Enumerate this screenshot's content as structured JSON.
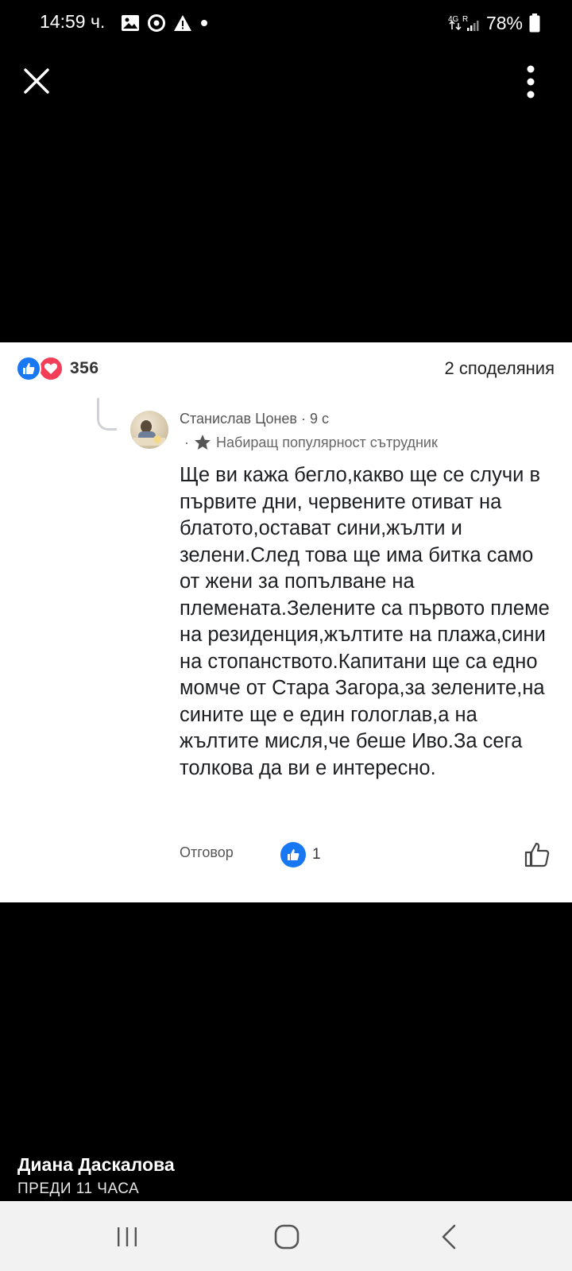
{
  "status_bar": {
    "time": "14:59 ч.",
    "network": "4G",
    "battery": "78%"
  },
  "post": {
    "reactions_count": "356",
    "shares": "2 споделяния",
    "author": "Диана Даскалова",
    "time_ago": "ПРЕДИ 11 ЧАСА"
  },
  "comment": {
    "author": "Станислав Цонев",
    "time": "· 9 с",
    "badge": "Набиращ популярност сътрудник",
    "text": "Ще ви кажа бегло,какво ще се случи в първите дни,  червените отиват на блатото,остават сини,жълти и зелени.След това ще има битка само от жени за попълване на племената.Зелените са първото племе на резиденция,жълтите на плажа,сини на стопанството.Капитани ще са едно момче от Стара Загора,за зелените,на сините ще е един гологлав,а на жълтите мисля,че беше Иво.За сега толкова да ви е интересно.",
    "reply_label": "Отговор",
    "like_count": "1"
  },
  "colors": {
    "like_blue": "#1877f2",
    "love_red": "#f33e58"
  }
}
